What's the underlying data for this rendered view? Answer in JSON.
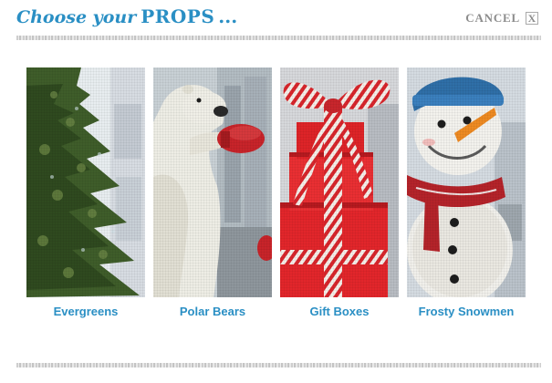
{
  "header": {
    "title_script": "Choose your",
    "title_bold": "PROPS",
    "title_dots": "...",
    "cancel_label": "CANCEL",
    "close_glyph": "X"
  },
  "props": [
    {
      "label": "Evergreens",
      "icon": "evergreen-tree"
    },
    {
      "label": "Polar Bears",
      "icon": "polar-bear-boxing"
    },
    {
      "label": "Gift Boxes",
      "icon": "gift-boxes"
    },
    {
      "label": "Frosty Snowmen",
      "icon": "snowman"
    }
  ],
  "colors": {
    "accent": "#2a8fc4",
    "cancel_text": "#8c8c8c",
    "gift_red": "#e3262b",
    "boxing_glove": "#c8242a"
  }
}
